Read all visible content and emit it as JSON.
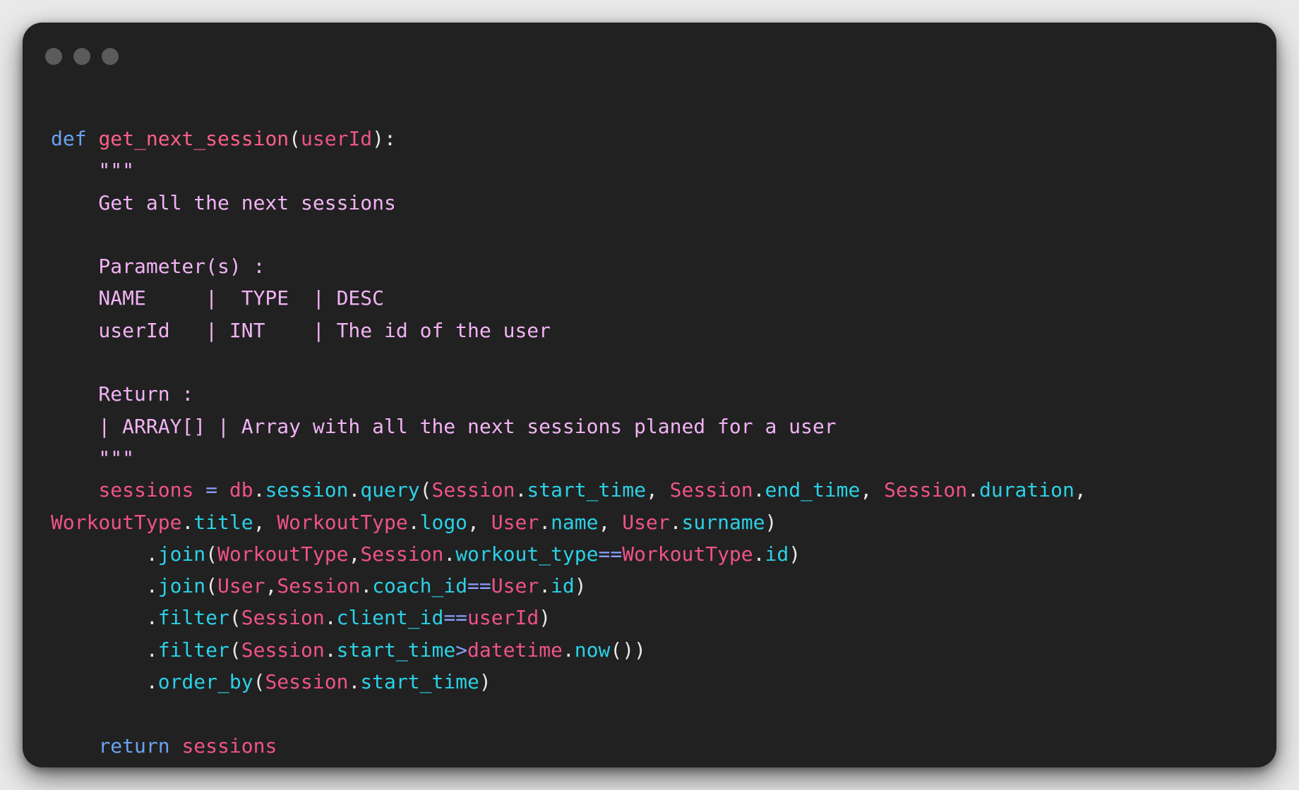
{
  "window": {
    "dots": [
      "close-dot",
      "minimize-dot",
      "maximize-dot"
    ],
    "colors": {
      "background": "#212121",
      "keyword": "#6aa2f0",
      "identifier": "#f0528a",
      "attribute": "#2ad1e6",
      "docstring": "#f2b3f5",
      "operator": "#8aa0ff"
    }
  },
  "code": {
    "lines": [
      [
        {
          "t": "def",
          "c": "kw"
        },
        {
          "t": " ",
          "c": "pun"
        },
        {
          "t": "get_next_session",
          "c": "fn"
        },
        {
          "t": "(",
          "c": "pun"
        },
        {
          "t": "userId",
          "c": "id"
        },
        {
          "t": "):",
          "c": "pun"
        }
      ],
      [
        {
          "t": "    \"\"\"",
          "c": "doc"
        }
      ],
      [
        {
          "t": "    Get all the next sessions",
          "c": "doc"
        }
      ],
      [
        {
          "t": "",
          "c": "doc"
        }
      ],
      [
        {
          "t": "    Parameter(s) :",
          "c": "doc"
        }
      ],
      [
        {
          "t": "    NAME     |  TYPE  | DESC",
          "c": "doc"
        }
      ],
      [
        {
          "t": "    userId   | INT    | The id of the user",
          "c": "doc"
        }
      ],
      [
        {
          "t": "",
          "c": "doc"
        }
      ],
      [
        {
          "t": "    Return :",
          "c": "doc"
        }
      ],
      [
        {
          "t": "    | ARRAY[] | Array with all the next sessions planed for a user",
          "c": "doc"
        }
      ],
      [
        {
          "t": "    \"\"\"",
          "c": "doc"
        }
      ],
      [
        {
          "t": "    ",
          "c": "pun"
        },
        {
          "t": "sessions",
          "c": "id"
        },
        {
          "t": " ",
          "c": "pun"
        },
        {
          "t": "=",
          "c": "op"
        },
        {
          "t": " ",
          "c": "pun"
        },
        {
          "t": "db",
          "c": "id"
        },
        {
          "t": ".",
          "c": "pun"
        },
        {
          "t": "session",
          "c": "at"
        },
        {
          "t": ".",
          "c": "pun"
        },
        {
          "t": "query",
          "c": "at"
        },
        {
          "t": "(",
          "c": "pun"
        },
        {
          "t": "Session",
          "c": "id"
        },
        {
          "t": ".",
          "c": "pun"
        },
        {
          "t": "start_time",
          "c": "at"
        },
        {
          "t": ", ",
          "c": "pun"
        },
        {
          "t": "Session",
          "c": "id"
        },
        {
          "t": ".",
          "c": "pun"
        },
        {
          "t": "end_time",
          "c": "at"
        },
        {
          "t": ", ",
          "c": "pun"
        },
        {
          "t": "Session",
          "c": "id"
        },
        {
          "t": ".",
          "c": "pun"
        },
        {
          "t": "duration",
          "c": "at"
        },
        {
          "t": ",",
          "c": "pun"
        }
      ],
      [
        {
          "t": "WorkoutType",
          "c": "id"
        },
        {
          "t": ".",
          "c": "pun"
        },
        {
          "t": "title",
          "c": "at"
        },
        {
          "t": ", ",
          "c": "pun"
        },
        {
          "t": "WorkoutType",
          "c": "id"
        },
        {
          "t": ".",
          "c": "pun"
        },
        {
          "t": "logo",
          "c": "at"
        },
        {
          "t": ", ",
          "c": "pun"
        },
        {
          "t": "User",
          "c": "id"
        },
        {
          "t": ".",
          "c": "pun"
        },
        {
          "t": "name",
          "c": "at"
        },
        {
          "t": ", ",
          "c": "pun"
        },
        {
          "t": "User",
          "c": "id"
        },
        {
          "t": ".",
          "c": "pun"
        },
        {
          "t": "surname",
          "c": "at"
        },
        {
          "t": ")",
          "c": "pun"
        }
      ],
      [
        {
          "t": "        .",
          "c": "pun"
        },
        {
          "t": "join",
          "c": "at"
        },
        {
          "t": "(",
          "c": "pun"
        },
        {
          "t": "WorkoutType",
          "c": "id"
        },
        {
          "t": ",",
          "c": "pun"
        },
        {
          "t": "Session",
          "c": "id"
        },
        {
          "t": ".",
          "c": "pun"
        },
        {
          "t": "workout_type",
          "c": "at"
        },
        {
          "t": "==",
          "c": "op"
        },
        {
          "t": "WorkoutType",
          "c": "id"
        },
        {
          "t": ".",
          "c": "pun"
        },
        {
          "t": "id",
          "c": "at"
        },
        {
          "t": ")",
          "c": "pun"
        }
      ],
      [
        {
          "t": "        .",
          "c": "pun"
        },
        {
          "t": "join",
          "c": "at"
        },
        {
          "t": "(",
          "c": "pun"
        },
        {
          "t": "User",
          "c": "id"
        },
        {
          "t": ",",
          "c": "pun"
        },
        {
          "t": "Session",
          "c": "id"
        },
        {
          "t": ".",
          "c": "pun"
        },
        {
          "t": "coach_id",
          "c": "at"
        },
        {
          "t": "==",
          "c": "op"
        },
        {
          "t": "User",
          "c": "id"
        },
        {
          "t": ".",
          "c": "pun"
        },
        {
          "t": "id",
          "c": "at"
        },
        {
          "t": ")",
          "c": "pun"
        }
      ],
      [
        {
          "t": "        .",
          "c": "pun"
        },
        {
          "t": "filter",
          "c": "at"
        },
        {
          "t": "(",
          "c": "pun"
        },
        {
          "t": "Session",
          "c": "id"
        },
        {
          "t": ".",
          "c": "pun"
        },
        {
          "t": "client_id",
          "c": "at"
        },
        {
          "t": "==",
          "c": "op"
        },
        {
          "t": "userId",
          "c": "id"
        },
        {
          "t": ")",
          "c": "pun"
        }
      ],
      [
        {
          "t": "        .",
          "c": "pun"
        },
        {
          "t": "filter",
          "c": "at"
        },
        {
          "t": "(",
          "c": "pun"
        },
        {
          "t": "Session",
          "c": "id"
        },
        {
          "t": ".",
          "c": "pun"
        },
        {
          "t": "start_time",
          "c": "at"
        },
        {
          "t": ">",
          "c": "op"
        },
        {
          "t": "datetime",
          "c": "id"
        },
        {
          "t": ".",
          "c": "pun"
        },
        {
          "t": "now",
          "c": "at"
        },
        {
          "t": "())",
          "c": "pun"
        }
      ],
      [
        {
          "t": "        .",
          "c": "pun"
        },
        {
          "t": "order_by",
          "c": "at"
        },
        {
          "t": "(",
          "c": "pun"
        },
        {
          "t": "Session",
          "c": "id"
        },
        {
          "t": ".",
          "c": "pun"
        },
        {
          "t": "start_time",
          "c": "at"
        },
        {
          "t": ")",
          "c": "pun"
        }
      ],
      [
        {
          "t": "",
          "c": "pun"
        }
      ],
      [
        {
          "t": "    ",
          "c": "pun"
        },
        {
          "t": "return",
          "c": "kw"
        },
        {
          "t": " ",
          "c": "pun"
        },
        {
          "t": "sessions",
          "c": "id"
        }
      ]
    ]
  }
}
